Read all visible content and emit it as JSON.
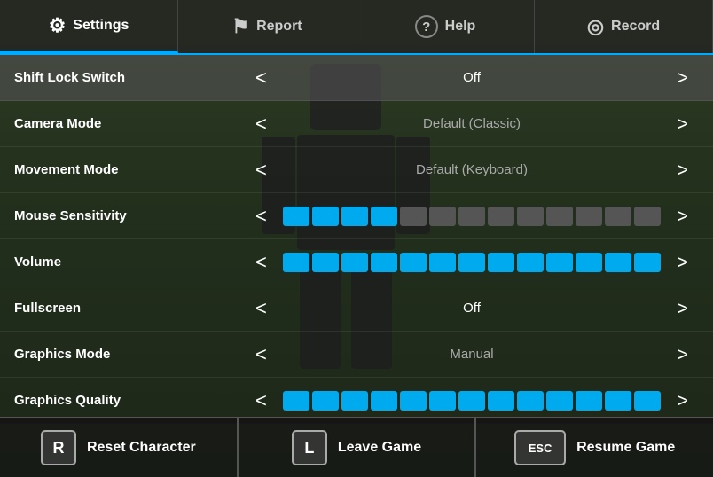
{
  "topbar": {
    "tabs": [
      {
        "id": "settings",
        "label": "Settings",
        "icon": "⚙",
        "active": true
      },
      {
        "id": "report",
        "label": "Report",
        "icon": "⚑",
        "active": false
      },
      {
        "id": "help",
        "label": "Help",
        "icon": "?",
        "active": false
      },
      {
        "id": "record",
        "label": "Record",
        "icon": "◎",
        "active": false
      }
    ]
  },
  "settings": {
    "rows": [
      {
        "id": "shift-lock",
        "label": "Shift Lock Switch",
        "type": "toggle",
        "value": "Off",
        "highlighted": true
      },
      {
        "id": "camera-mode",
        "label": "Camera Mode",
        "type": "toggle",
        "value": "Default (Classic)",
        "highlighted": false
      },
      {
        "id": "movement-mode",
        "label": "Movement Mode",
        "type": "toggle",
        "value": "Default (Keyboard)",
        "highlighted": false
      },
      {
        "id": "mouse-sensitivity",
        "label": "Mouse Sensitivity",
        "type": "slider",
        "filled": 4,
        "total": 13,
        "highlighted": false
      },
      {
        "id": "volume",
        "label": "Volume",
        "type": "slider",
        "filled": 13,
        "total": 13,
        "highlighted": false
      },
      {
        "id": "fullscreen",
        "label": "Fullscreen",
        "type": "toggle",
        "value": "Off",
        "highlighted": false
      },
      {
        "id": "graphics-mode",
        "label": "Graphics Mode",
        "type": "toggle",
        "value": "Manual",
        "highlighted": false
      },
      {
        "id": "graphics-quality",
        "label": "Graphics Quality",
        "type": "slider",
        "filled": 13,
        "total": 13,
        "highlighted": false
      }
    ]
  },
  "actions": [
    {
      "id": "reset",
      "key": "R",
      "label": "Reset Character",
      "wide": false
    },
    {
      "id": "leave",
      "key": "L",
      "label": "Leave Game",
      "wide": false
    },
    {
      "id": "resume",
      "key": "ESC",
      "label": "Resume Game",
      "wide": true
    }
  ],
  "colors": {
    "filled_block": "#00aaee",
    "empty_block": "#555555",
    "active_tab_underline": "#00aaff"
  }
}
